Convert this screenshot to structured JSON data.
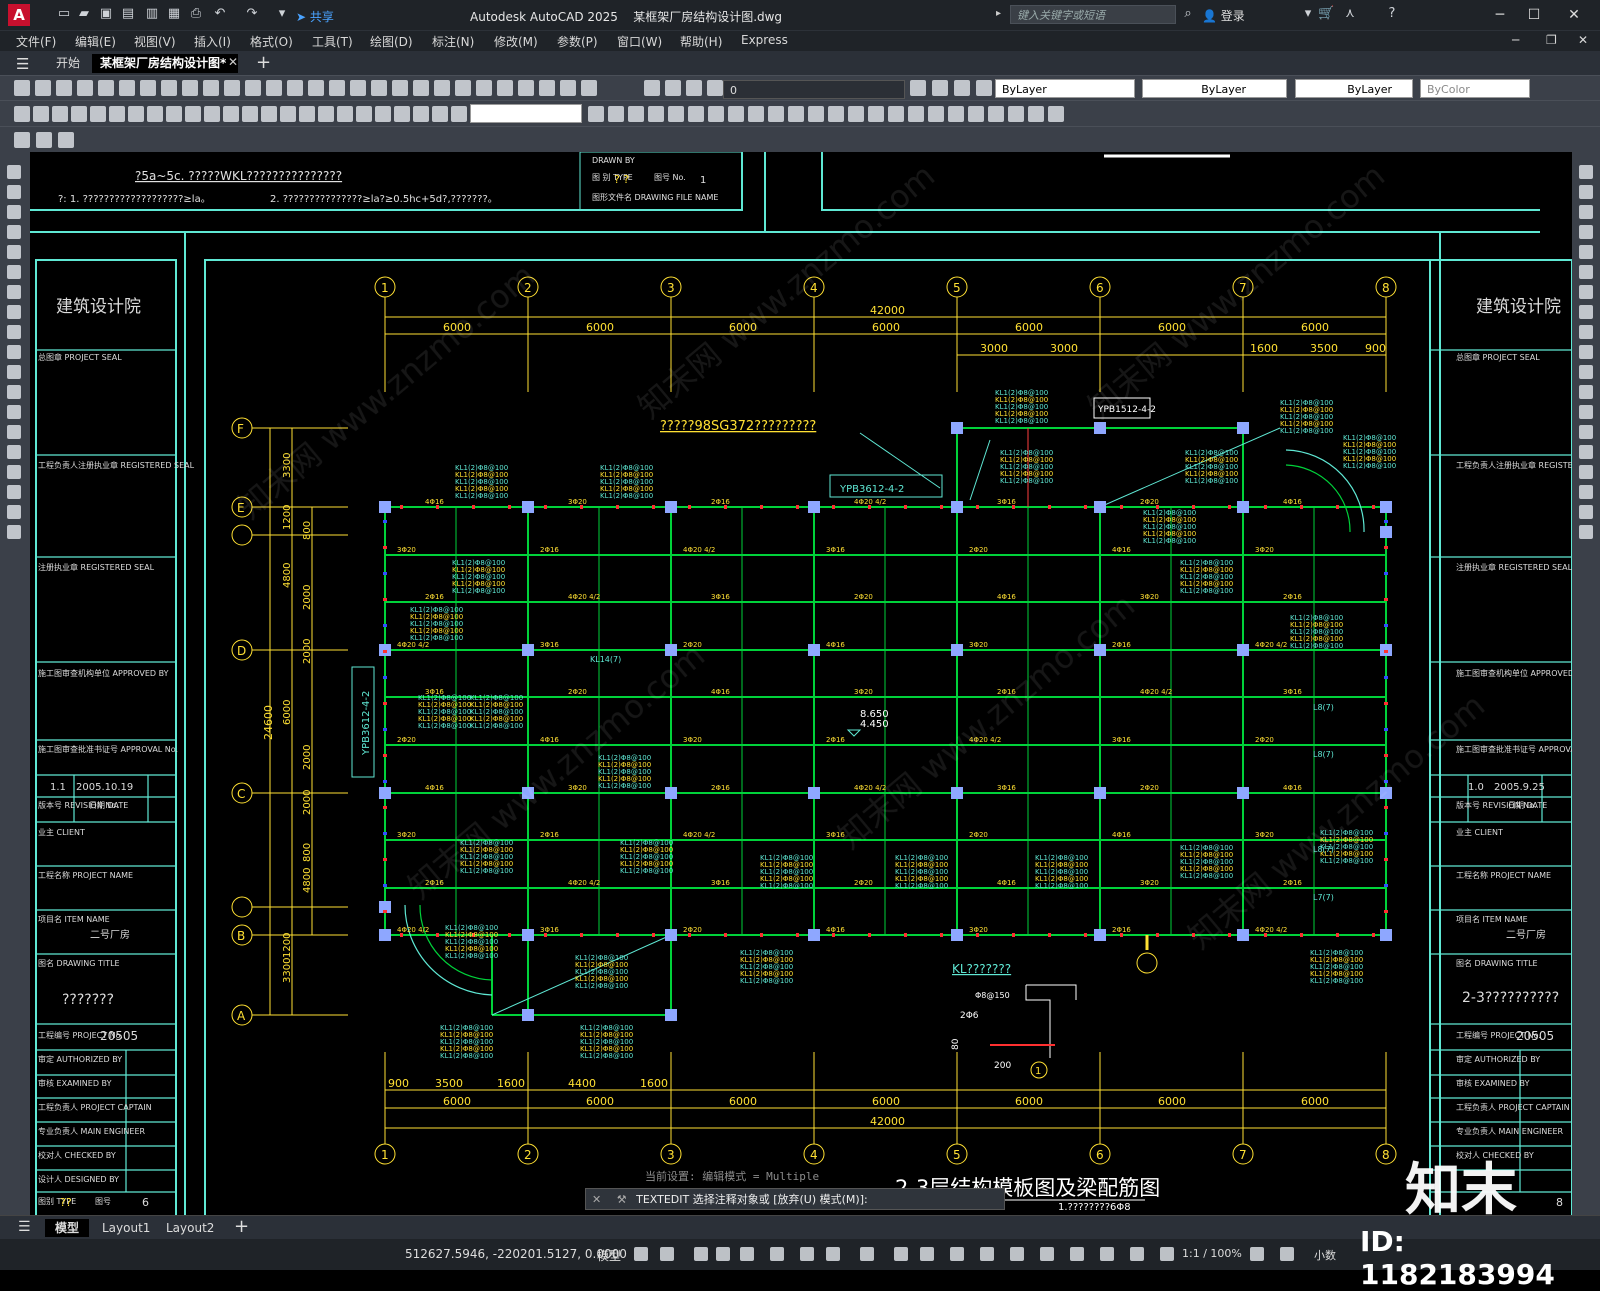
{
  "app": {
    "title": "Autodesk AutoCAD 2025",
    "file": "某框架厂房结构设计图.dwg",
    "search_placeholder": "键入关键字或短语",
    "login": "登录",
    "share": "共享",
    "logo": "A"
  },
  "menu": [
    "文件(F)",
    "编辑(E)",
    "视图(V)",
    "插入(I)",
    "格式(O)",
    "工具(T)",
    "绘图(D)",
    "标注(N)",
    "修改(M)",
    "参数(P)",
    "窗口(W)",
    "帮助(H)",
    "Express"
  ],
  "tabs": {
    "start": "开始",
    "doc": "某框架厂房结构设计图*"
  },
  "properties": {
    "layer": "0",
    "color": "ByLayer",
    "linetype": "ByLayer",
    "lineweight": "ByLayer",
    "plotstyle": "ByColor"
  },
  "drawing": {
    "notes": {
      "n1": "?5a~5c. ?????WKL???????????????",
      "n2": "?:   1. ???????????????????≥la。",
      "n3": "2. ???????????????≥la?≥0.5hc+5d?,???????。",
      "n4": "?????98SG372?????????",
      "drawn_by": "DRAWN BY",
      "type_label": "图 别 TYPE",
      "type_val": "? ?",
      "no_label": "图号 No.",
      "no_val": "1",
      "file_name": "图形文件名 DRAWING FILE NAME"
    },
    "column_grid": [
      "1",
      "2",
      "3",
      "4",
      "5",
      "6",
      "7",
      "8"
    ],
    "row_grid": [
      "F",
      "E",
      "",
      "D",
      "C",
      "",
      "B",
      "A"
    ],
    "dims_top_total": "42000",
    "dims_top": [
      "6000",
      "6000",
      "6000",
      "6000",
      "6000",
      "6000",
      "6000"
    ],
    "dims_top_sub": [
      "3000",
      "3000",
      "1600",
      "3500",
      "900"
    ],
    "dims_bottom_sub": [
      "900",
      "3500",
      "1600",
      "4400",
      "1600"
    ],
    "dims_bottom": [
      "6000",
      "6000",
      "6000",
      "6000",
      "6000",
      "6000",
      "6000"
    ],
    "dims_bottom_total": "42000",
    "dims_left_total": "24600",
    "dims_left": [
      "3300",
      "1200",
      "4800",
      "800",
      "2000",
      "2000",
      "6000",
      "2000",
      "2000",
      "800",
      "4800",
      "1200",
      "3300"
    ],
    "tags": {
      "ypb1": "YPB3612-4-2",
      "ypb2": "YPB1512-4-2",
      "ypb3": "YPB3612-4-2",
      "level": "8.650\n4.450",
      "kl_detail": "KL???????",
      "phi": "Φ8@150",
      "bar": "2Φ6",
      "dim80": "80",
      "dim200": "200",
      "kl14": "KL14(7)",
      "l8": "L8(7)",
      "l7": "L7(7)"
    },
    "sheet_title": "2-3层结构模板图及梁配筋图",
    "sheet_sub": "1.????????6Φ8",
    "title_block_left": {
      "institute": "建筑设计院",
      "project_seal": "总图章 PROJECT SEAL",
      "registered": "工程负责人注册执业章 REGISTERED SEAL",
      "registered2": "注册执业章 REGISTERED SEAL",
      "approved": "施工图审查机构单位 APPROVED BY",
      "approval_no": "施工图审查批准书证号 APPROVAL No.",
      "rev": "1.1",
      "date": "2005.10.19",
      "rev_label": "版本号 REVISION No.",
      "date_label": "日期 DATE",
      "client": "业主 CLIENT",
      "project_name": "工程名称 PROJECT NAME",
      "item_name": "项目名 ITEM NAME",
      "item_val": "二号厂房",
      "drawing_title": "图名 DRAWING TITLE",
      "drawing_title_val": "???????",
      "project_no": "工程编号 PROJECT No.",
      "project_no_val": "20505",
      "authorized": "审定 AUTHORIZED BY",
      "examined": "审核 EXAMINED BY",
      "captain": "工程负责人 PROJECT CAPTAIN",
      "engineer": "专业负责人 MAIN ENGINEER",
      "checked": "校对人 CHECKED BY",
      "designed": "设计人 DESIGNED BY",
      "type": "图别 TYPE",
      "type_val": "??",
      "no": "图号",
      "no_val": "6"
    },
    "title_block_right": {
      "institute": "建筑设计院",
      "rev": "1.0",
      "date": "2005.9.25",
      "item_val": "二号厂房",
      "drawing_title_val": "2-3??????????",
      "project_no_val": "20505",
      "no_val": "8"
    }
  },
  "command": {
    "hint": "当前设置: 编辑模式 = Multiple",
    "prompt": "TEXTEDIT 选择注释对象或 [放弃(U) 模式(M)]:"
  },
  "layouts": [
    "模型",
    "Layout1",
    "Layout2"
  ],
  "status": {
    "coords": "512627.5946, -220201.5127, 0.0000",
    "mode": "模型",
    "scale": "1:1 / 100%",
    "units": "小数"
  },
  "watermark": {
    "id": "ID: 1182183994",
    "logo": "知末",
    "site": "知末网 www.znzmo.com"
  }
}
